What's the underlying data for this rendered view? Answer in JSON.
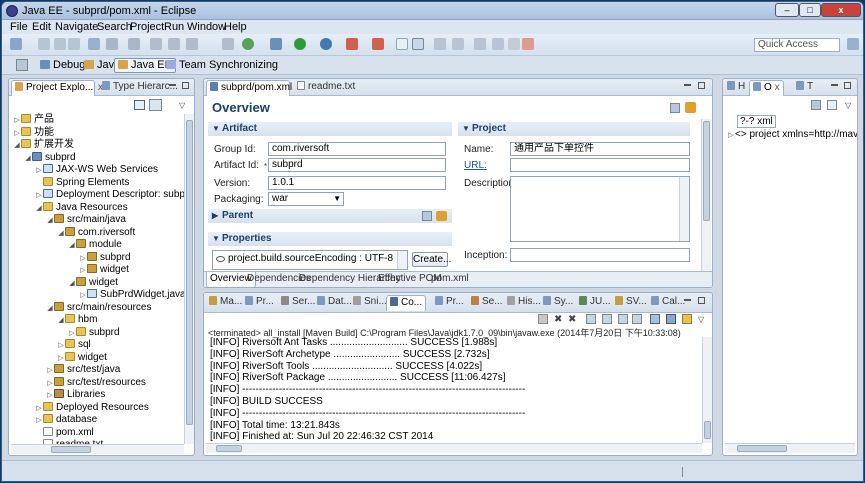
{
  "window": {
    "title": "Java EE - subprd/pom.xml - Eclipse",
    "min": "–",
    "max": "□",
    "close": "x"
  },
  "menu": [
    "File",
    "Edit",
    "Navigate",
    "Search",
    "Project",
    "Run",
    "Window",
    "Help"
  ],
  "quick_access": {
    "placeholder": "Quick Access"
  },
  "perspectives": [
    {
      "label": "Debug",
      "icon": "debug-icon"
    },
    {
      "label": "Java",
      "icon": "java-icon"
    },
    {
      "label": "Java EE",
      "icon": "javaee-icon",
      "selected": true
    },
    {
      "label": "Team Synchronizing",
      "icon": "sync-icon"
    }
  ],
  "explorer": {
    "tabs": [
      {
        "label": "Project Explo...",
        "close": "x"
      },
      {
        "label": "Type Hierarc..."
      }
    ],
    "tree": [
      {
        "label": "产品",
        "depth": 0,
        "twisty": "▷",
        "type": "fold"
      },
      {
        "label": "功能",
        "depth": 0,
        "twisty": "▷",
        "type": "fold"
      },
      {
        "label": "扩展开发",
        "depth": 0,
        "twisty": "◢",
        "type": "fold"
      },
      {
        "label": "subprd",
        "depth": 1,
        "twisty": "◢",
        "type": "proj"
      },
      {
        "label": "JAX-WS Web Services",
        "depth": 2,
        "twisty": "▷",
        "type": "jfile"
      },
      {
        "label": "Spring Elements",
        "depth": 2,
        "twisty": "",
        "type": "fold"
      },
      {
        "label": "Deployment Descriptor: subprd",
        "depth": 2,
        "twisty": "▷",
        "type": "jfile"
      },
      {
        "label": "Java Resources",
        "depth": 2,
        "twisty": "◢",
        "type": "fold"
      },
      {
        "label": "src/main/java",
        "depth": 3,
        "twisty": "◢",
        "type": "pkg"
      },
      {
        "label": "com.riversoft",
        "depth": 4,
        "twisty": "◢",
        "type": "pkg"
      },
      {
        "label": "module",
        "depth": 5,
        "twisty": "◢",
        "type": "pkg"
      },
      {
        "label": "subprd",
        "depth": 6,
        "twisty": "▷",
        "type": "pkg"
      },
      {
        "label": "widget",
        "depth": 6,
        "twisty": "▷",
        "type": "pkg"
      },
      {
        "label": "widget",
        "depth": 5,
        "twisty": "◢",
        "type": "pkg"
      },
      {
        "label": "SubPrdWidget.java",
        "depth": 6,
        "twisty": "▷",
        "type": "jfile"
      },
      {
        "label": "src/main/resources",
        "depth": 3,
        "twisty": "◢",
        "type": "pkg"
      },
      {
        "label": "hbm",
        "depth": 4,
        "twisty": "◢",
        "type": "fold"
      },
      {
        "label": "subprd",
        "depth": 5,
        "twisty": "▷",
        "type": "fold"
      },
      {
        "label": "sql",
        "depth": 4,
        "twisty": "▷",
        "type": "fold"
      },
      {
        "label": "widget",
        "depth": 4,
        "twisty": "▷",
        "type": "fold"
      },
      {
        "label": "src/test/java",
        "depth": 3,
        "twisty": "▷",
        "type": "pkg"
      },
      {
        "label": "src/test/resources",
        "depth": 3,
        "twisty": "▷",
        "type": "pkg"
      },
      {
        "label": "Libraries",
        "depth": 3,
        "twisty": "▷",
        "type": "lib"
      },
      {
        "label": "Deployed Resources",
        "depth": 2,
        "twisty": "▷",
        "type": "fold"
      },
      {
        "label": "database",
        "depth": 2,
        "twisty": "▷",
        "type": "fold"
      },
      {
        "label": "pom.xml",
        "depth": 2,
        "twisty": "",
        "type": "file"
      },
      {
        "label": "readme.txt",
        "depth": 2,
        "twisty": "",
        "type": "file"
      }
    ]
  },
  "editor": {
    "tabs": [
      {
        "label": "subprd/pom.xml",
        "close": "x"
      },
      {
        "label": "readme.txt"
      }
    ],
    "heading": "Overview",
    "artifact": {
      "title": "Artifact",
      "group_id_label": "Group Id:",
      "group_id": "com.riversoft",
      "artifact_id_label": "Artifact Id:",
      "artifact_id": "subprd",
      "version_label": "Version:",
      "version": "1.0.1",
      "packaging_label": "Packaging:",
      "packaging": "war"
    },
    "project": {
      "title": "Project",
      "name_label": "Name:",
      "name": "通用产品下单控件",
      "url_label": "URL:",
      "url": "",
      "description_label": "Description:",
      "inception_label": "Inception:"
    },
    "parent": {
      "title": "Parent"
    },
    "properties": {
      "title": "Properties",
      "item": "project.build.sourceEncoding : UTF-8",
      "create": "Create..."
    },
    "bottom_tabs": [
      "Overview",
      "Dependencies",
      "Dependency Hierarchy",
      "Effective POM",
      "pom.xml"
    ]
  },
  "console": {
    "tabs": [
      "Ma...",
      "Pr...",
      "Ser...",
      "Dat...",
      "Sni...",
      "Co...",
      "Pr...",
      "Se...",
      "His...",
      "Sy...",
      "JU...",
      "SV...",
      "Cal..."
    ],
    "active_tab": 5,
    "header": "<terminated> all_install [Maven Build] C:\\Program Files\\Java\\jdk1.7.0_09\\bin\\javaw.exe (2014年7月20日 下午10:33:08)",
    "lines": [
      "[INFO] Riversoft Ant Tasks ............................ SUCCESS [1.988s]",
      "[INFO] RiverSoft Archetype ........................ SUCCESS [2.732s]",
      "[INFO] RiverSoft Tools ............................. SUCCESS [4.022s]",
      "[INFO] RiverSoft Package ......................... SUCCESS [11:06.427s]",
      "[INFO] -------------------------------------------------------------------------------------",
      "[INFO] BUILD SUCCESS",
      "[INFO] -------------------------------------------------------------------------------------",
      "[INFO] Total time: 13:21.843s",
      "[INFO] Finished at: Sun Jul 20 22:46:32 CST 2014"
    ]
  },
  "outline": {
    "tabs": [
      {
        "label": "H"
      },
      {
        "label": "O",
        "close": "x"
      },
      {
        "label": "T"
      }
    ],
    "items": [
      {
        "label": "?-? xml",
        "twisty": ""
      },
      {
        "label": "<> project xmlns=http://maven",
        "twisty": "▷"
      }
    ]
  },
  "colors": {
    "accent": "#1d3f6e",
    "title_gradient": "#a9c1de",
    "link": "#1a55b0"
  }
}
